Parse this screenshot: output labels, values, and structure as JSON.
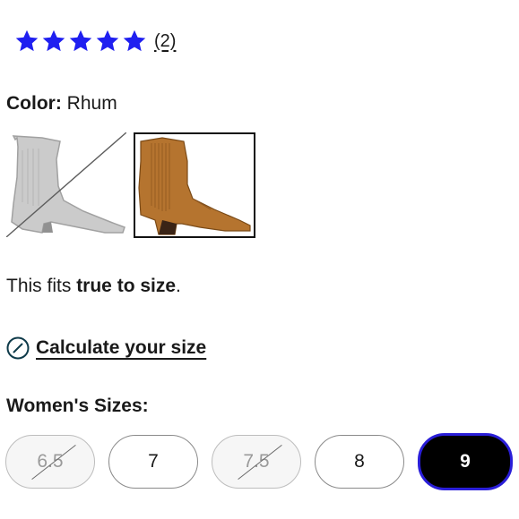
{
  "rating": {
    "stars": 5,
    "star_color": "#1f1ff0",
    "review_count": "(2)"
  },
  "color": {
    "label": "Color:",
    "value": "Rhum",
    "swatches": [
      {
        "name": "unavailable-variant",
        "available": false
      },
      {
        "name": "Rhum",
        "available": true,
        "selected": true,
        "color": "#b5742f"
      }
    ]
  },
  "fit": {
    "prefix": "This fits ",
    "emphasis": "true to size",
    "suffix": "."
  },
  "calculator": {
    "label": "Calculate your size",
    "icon": "calculator-icon"
  },
  "sizes": {
    "title": "Women's Sizes:",
    "options": [
      {
        "label": "6.5",
        "available": false
      },
      {
        "label": "7",
        "available": true
      },
      {
        "label": "7.5",
        "available": false
      },
      {
        "label": "8",
        "available": true
      },
      {
        "label": "9",
        "available": true,
        "selected": true
      }
    ],
    "selected_border_color": "#2a1ed8"
  }
}
